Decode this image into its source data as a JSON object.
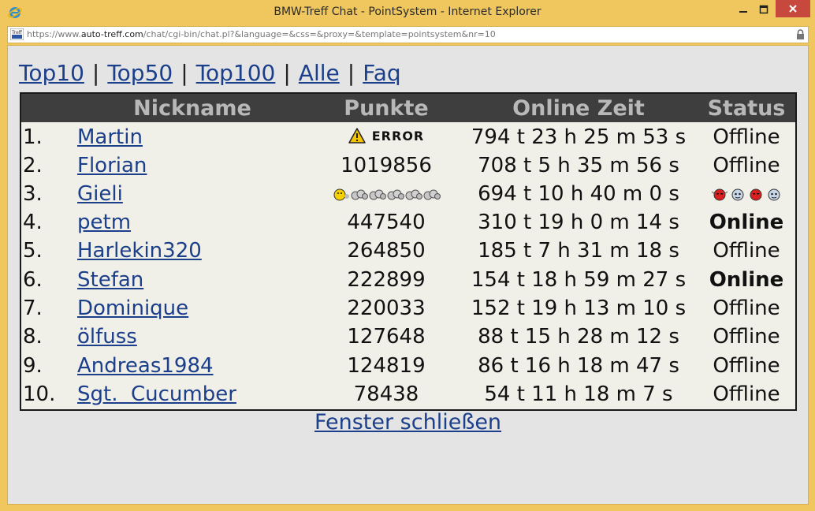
{
  "window": {
    "title": "BMW-Treff Chat - PointSystem - Internet Explorer",
    "url_prefix": "https://www.",
    "url_host": "auto-treff.com",
    "url_rest": "/chat/cgi-bin/chat.pl?&language=&css=&proxy=&template=pointsystem&nr=10"
  },
  "nav": {
    "top10": "Top10",
    "top50": "Top50",
    "top100": "Top100",
    "alle": "Alle",
    "faq": "Faq",
    "sep": "|"
  },
  "table": {
    "headers": {
      "nickname": "Nickname",
      "punkte": "Punkte",
      "online_zeit": "Online Zeit",
      "status": "Status"
    },
    "rows": [
      {
        "rank": "1.",
        "nick": "Martin",
        "points": "ERROR",
        "time": "794 t 23 h 25 m 53 s",
        "status": "Offline"
      },
      {
        "rank": "2.",
        "nick": "Florian",
        "points": "1019856",
        "time": "708 t 5 h 35 m 56 s",
        "status": "Offline"
      },
      {
        "rank": "3.",
        "nick": "Gieli",
        "points": "",
        "time": "694 t 10 h 40 m 0 s",
        "status": ""
      },
      {
        "rank": "4.",
        "nick": "petm",
        "points": "447540",
        "time": "310 t 19 h 0 m 14 s",
        "status": "Online"
      },
      {
        "rank": "5.",
        "nick": "Harlekin320",
        "points": "264850",
        "time": "185 t 7 h 31 m 18 s",
        "status": "Offline"
      },
      {
        "rank": "6.",
        "nick": "Stefan",
        "points": "222899",
        "time": "154 t 18 h 59 m 27 s",
        "status": "Online"
      },
      {
        "rank": "7.",
        "nick": "Dominique",
        "points": "220033",
        "time": "152 t 19 h 13 m 10 s",
        "status": "Offline"
      },
      {
        "rank": "8.",
        "nick": "ölfuss",
        "points": "127648",
        "time": "88 t 15 h 28 m 12 s",
        "status": "Offline"
      },
      {
        "rank": "9.",
        "nick": "Andreas1984",
        "points": "124819",
        "time": "86 t 16 h 18 m 47 s",
        "status": "Offline"
      },
      {
        "rank": "10.",
        "nick": "Sgt.  Cucumber",
        "points": "78438",
        "time": "54 t 11 h 18 m 7 s",
        "status": "Offline"
      }
    ]
  },
  "close_link": "Fenster schließen",
  "icons": {
    "app": "internet-explorer-icon",
    "warning": "warning-icon",
    "lock": "lock-icon"
  }
}
